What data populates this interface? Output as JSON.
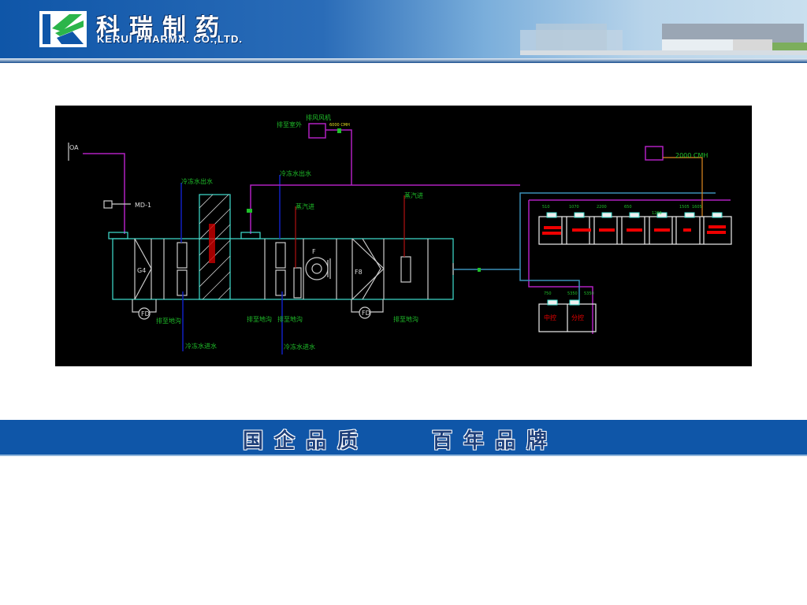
{
  "header": {
    "logo_cn": "科瑞制药",
    "logo_en": "KERUI PHARMA. CO.,LTD.",
    "colors": {
      "brand_blue": "#0f56a8",
      "logo_green": "#2bb54a"
    }
  },
  "diagram": {
    "oa": "OA",
    "damper": "MD-1",
    "filter_g4": "G4",
    "filter_f8": "F8",
    "fan": "F",
    "drain_fan_1": "FD",
    "drain_fan_2": "FD",
    "chw_out_1": "冷冻水出水",
    "chw_out_2": "冷冻水出水",
    "chw_in_1": "冷冻水进水",
    "chw_in_2": "冷冻水进水",
    "steam_in_1": "蒸汽进",
    "steam_in_2": "蒸汽进",
    "drain_1": "排至地沟",
    "drain_2": "排至地沟",
    "drain_3": "排至地沟",
    "drain_4": "排至地沟",
    "exhaust_out": "排至室外",
    "exhaust_fan": "排风风机",
    "exhaust_flow_1": "6000 CMH",
    "exhaust_flow_2": "2000 CMH",
    "room_airflows": [
      "510",
      "1070",
      "2200",
      "650",
      "1260",
      "1505",
      "1605"
    ],
    "lower_airflows": [
      "750",
      "5350",
      "5350"
    ],
    "lower_rooms": [
      "中控",
      "分控"
    ],
    "colors": {
      "duct": "#40e0d0",
      "purple": "#b020c0",
      "chw": "#1020c0",
      "steam": "#b01010",
      "green": "#1fc02a"
    }
  },
  "banner": {
    "slogan_left": "国企品质",
    "slogan_right": "百年品牌"
  }
}
